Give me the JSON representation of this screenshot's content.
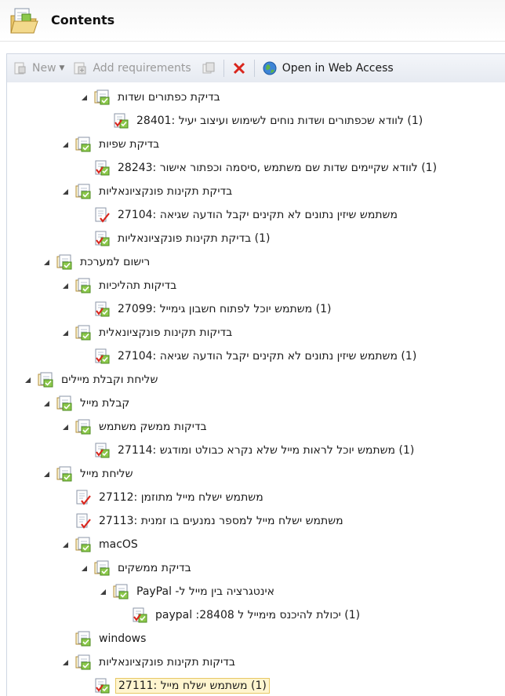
{
  "header": {
    "title": "Contents",
    "icon": "folder-document-icon"
  },
  "toolbar": {
    "new_label": "New",
    "add_requirements_label": "Add requirements",
    "open_web_label": "Open in Web Access"
  },
  "tree": [
    {
      "label": "בדיקת כפתורים ושדות",
      "type": "suite",
      "indent": 4,
      "expanded": true
    },
    {
      "label": "(1) לוודא שכפתורים ושדות נוחים לשימוש ועיצוב יעיל :28401",
      "type": "requirement",
      "indent": 5
    },
    {
      "label": "בדיקת שפיות",
      "type": "suite",
      "indent": 3,
      "expanded": true
    },
    {
      "label": "(1) לוודא שקיימים שדות שם משתמש ,סיסמה וכפתור אישור :28243",
      "type": "requirement",
      "indent": 4
    },
    {
      "label": "בדיקת תקינות פונקציונאליות",
      "type": "suite",
      "indent": 3,
      "expanded": true
    },
    {
      "label": "משתמש שיזין נתונים לא תקינים יקבל הודעה שגיאה :27104",
      "type": "testcase",
      "indent": 4
    },
    {
      "label": "(1) בדיקת תקינות פונקציונאליות",
      "type": "requirement",
      "indent": 4
    },
    {
      "label": "רישום למערכת",
      "type": "suite",
      "indent": 2,
      "expanded": true
    },
    {
      "label": "בדיקות תהליכיות",
      "type": "suite",
      "indent": 3,
      "expanded": true
    },
    {
      "label": "(1) משתמש יוכל לפתוח חשבון גימייל :27099",
      "type": "requirement",
      "indent": 4
    },
    {
      "label": "בדיקות תקינות פונקציונאלית",
      "type": "suite",
      "indent": 3,
      "expanded": true
    },
    {
      "label": "(1) משתמש שיזין נתונים לא תקינים יקבל הודעה שגיאה :27104",
      "type": "requirement",
      "indent": 4
    },
    {
      "label": "שליחת וקבלת מיילים",
      "type": "suite",
      "indent": 1,
      "expanded": true
    },
    {
      "label": "קבלת מייל",
      "type": "suite",
      "indent": 2,
      "expanded": true
    },
    {
      "label": "בדיקות ממשק משתמש",
      "type": "suite",
      "indent": 3,
      "expanded": true
    },
    {
      "label": "(1) משתמש יוכל לראות מייל שלא נקרא כבולט ומודגש :27114",
      "type": "requirement",
      "indent": 4
    },
    {
      "label": "שליחת מייל",
      "type": "suite",
      "indent": 2,
      "expanded": true
    },
    {
      "label": "משתמש ישלח מייל מתוזמן :27112",
      "type": "testcase",
      "indent": 3
    },
    {
      "label": "משתמש ישלח מייל למספר נמנעים בו זמנית :27113",
      "type": "testcase",
      "indent": 3
    },
    {
      "label": "macOS",
      "type": "suite",
      "indent": 3,
      "expanded": true
    },
    {
      "label": "בדיקת ממשקים",
      "type": "suite",
      "indent": 4,
      "expanded": true
    },
    {
      "label": "אינטגרציה בין מייל ל- PayPal",
      "type": "suite",
      "indent": 5,
      "expanded": true
    },
    {
      "label": "(1) יכולת להיכנס מימייל ל paypal :28408",
      "type": "requirement",
      "indent": 6
    },
    {
      "label": "windows",
      "type": "suite",
      "indent": 3,
      "expanded": false
    },
    {
      "label": "בדיקות תקינות פונקציונאליות",
      "type": "suite",
      "indent": 3,
      "expanded": true
    },
    {
      "label": "(1) משתמש ישלח מייל :27111",
      "type": "requirement",
      "indent": 4,
      "selected": true
    }
  ],
  "colors": {
    "selection_bg": "#fff5cf",
    "selection_border": "#e7c865",
    "delete_red": "#d9251c"
  }
}
